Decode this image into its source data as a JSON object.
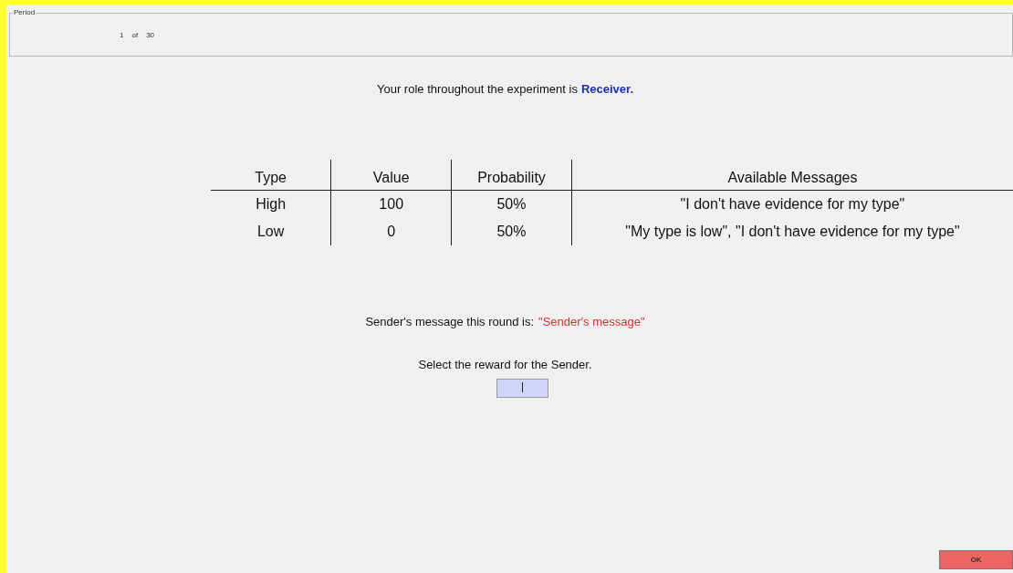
{
  "period": {
    "label": "Period",
    "current": "1",
    "of": "of",
    "total": "30"
  },
  "role": {
    "text": "Your role throughout the experiment is",
    "value": "Receiver."
  },
  "table": {
    "columns": [
      "Type",
      "Value",
      "Probability",
      "Available Messages"
    ],
    "rows": [
      [
        "High",
        "100",
        "50%",
        "\"I don't have evidence for my type\""
      ],
      [
        "Low",
        "0",
        "50%",
        "\"My type is low\", \"I don't have evidence for my type\""
      ]
    ]
  },
  "message": {
    "text": "Sender's message this round is:",
    "value": "\"Sender's message\""
  },
  "reward": {
    "prompt": "Select the reward for the Sender."
  },
  "buttons": [
    "OK"
  ]
}
